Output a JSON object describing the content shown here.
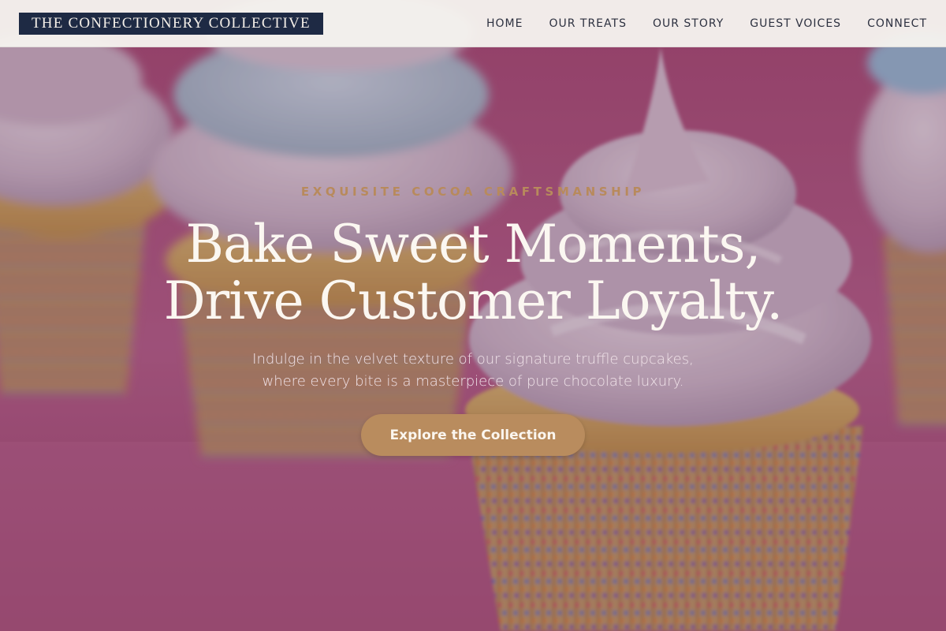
{
  "header": {
    "logo_text": "THE CONFECTIONERY COLLECTIVE",
    "nav": [
      "HOME",
      "OUR TREATS",
      "OUR STORY",
      "GUEST VOICES",
      "CONNECT"
    ]
  },
  "hero": {
    "eyebrow": "EXQUISITE COCOA CRAFTSMANSHIP",
    "headline_line1": "Bake Sweet Moments,",
    "headline_line2": "Drive Customer Loyalty.",
    "subtext_line1": "Indulge in the velvet texture of our signature truffle cupcakes,",
    "subtext_line2": "where every bite is a masterpiece of pure chocolate luxury.",
    "cta_label": "Explore the Collection",
    "background_image": "cupcakes-photo"
  },
  "colors": {
    "header_bg": "#f5f2ee",
    "logo_bg": "#1e2a44",
    "accent": "#b98c5e",
    "headline": "#fbf7f1",
    "hero_tint": "#b0577d"
  }
}
